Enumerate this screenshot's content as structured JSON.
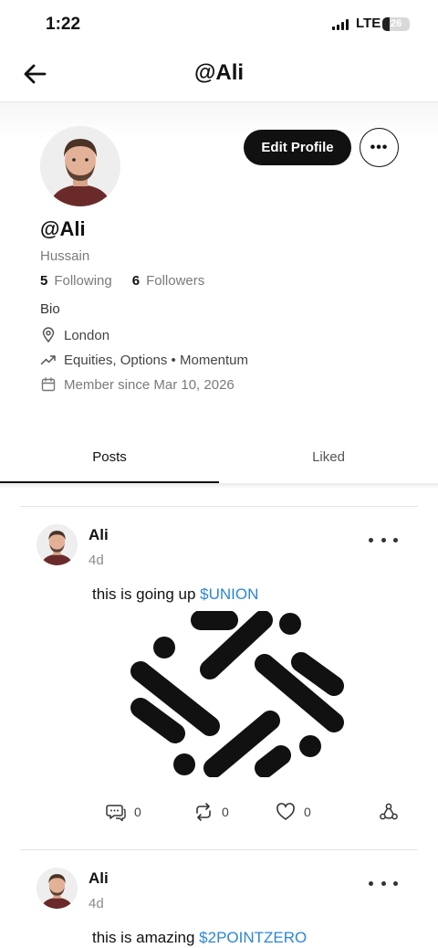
{
  "status_bar": {
    "time": "1:22",
    "network": "LTE",
    "battery": "26",
    "battery_level_percent": 26
  },
  "nav": {
    "title": "@Ali",
    "back_icon": "arrow-left-icon"
  },
  "profile": {
    "handle": "@Ali",
    "full_name": "Hussain",
    "following_count": "5",
    "following_label": "Following",
    "followers_count": "6",
    "followers_label": "Followers",
    "bio": "Bio",
    "location": "London",
    "interests": "Equities, Options • Momentum",
    "member_since": "Member since Mar 10, 2026",
    "edit_button": "Edit Profile",
    "more_button": "•••"
  },
  "tabs": [
    {
      "label": "Posts",
      "active": true
    },
    {
      "label": "Liked",
      "active": false
    }
  ],
  "posts": [
    {
      "author": "Ali",
      "time": "4d",
      "text": "this is going up ",
      "ticker": "$UNION",
      "has_image": true,
      "comments": "0",
      "reposts": "0",
      "likes": "0"
    },
    {
      "author": "Ali",
      "time": "4d",
      "text": "this is amazing ",
      "ticker": "$2POINTZERO",
      "has_image": false
    }
  ],
  "colors": {
    "accent_link": "#2a86d8",
    "primary_button": "#111111",
    "muted_text": "#7a7a7a"
  }
}
